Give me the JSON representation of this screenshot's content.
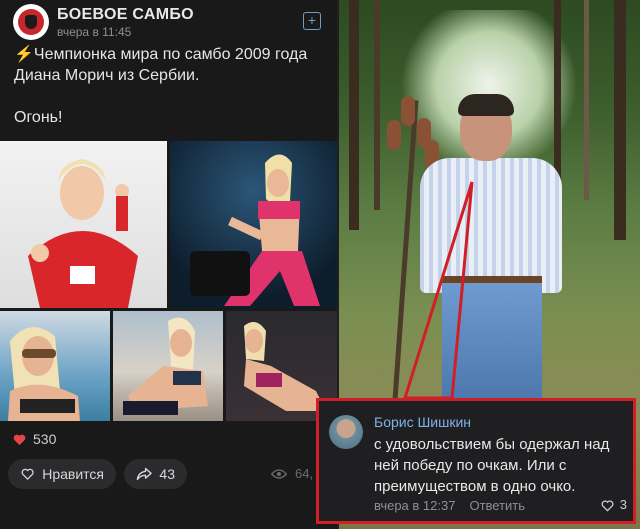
{
  "post": {
    "group_name": "БОЕВОЕ САМБО",
    "time": "вчера в 11:45",
    "text_line1": "⚡Чемпионка мира по самбо 2009 года Диана Морич из Сербии.",
    "text_line2": "Огонь!",
    "likes_count": "530",
    "like_label": "Нравится",
    "shares_count": "43",
    "views": "64,"
  },
  "comment": {
    "author": "Борис Шишкин",
    "text": "с удовольствием бы одержал над ней победу по очкам. Или с преимуществом в одно очко.",
    "time": "вчера в 12:37",
    "reply_label": "Ответить",
    "likes": "3"
  },
  "colors": {
    "accent": "#7fb0e8",
    "highlight": "#d01f26",
    "heart": "#e64646"
  }
}
